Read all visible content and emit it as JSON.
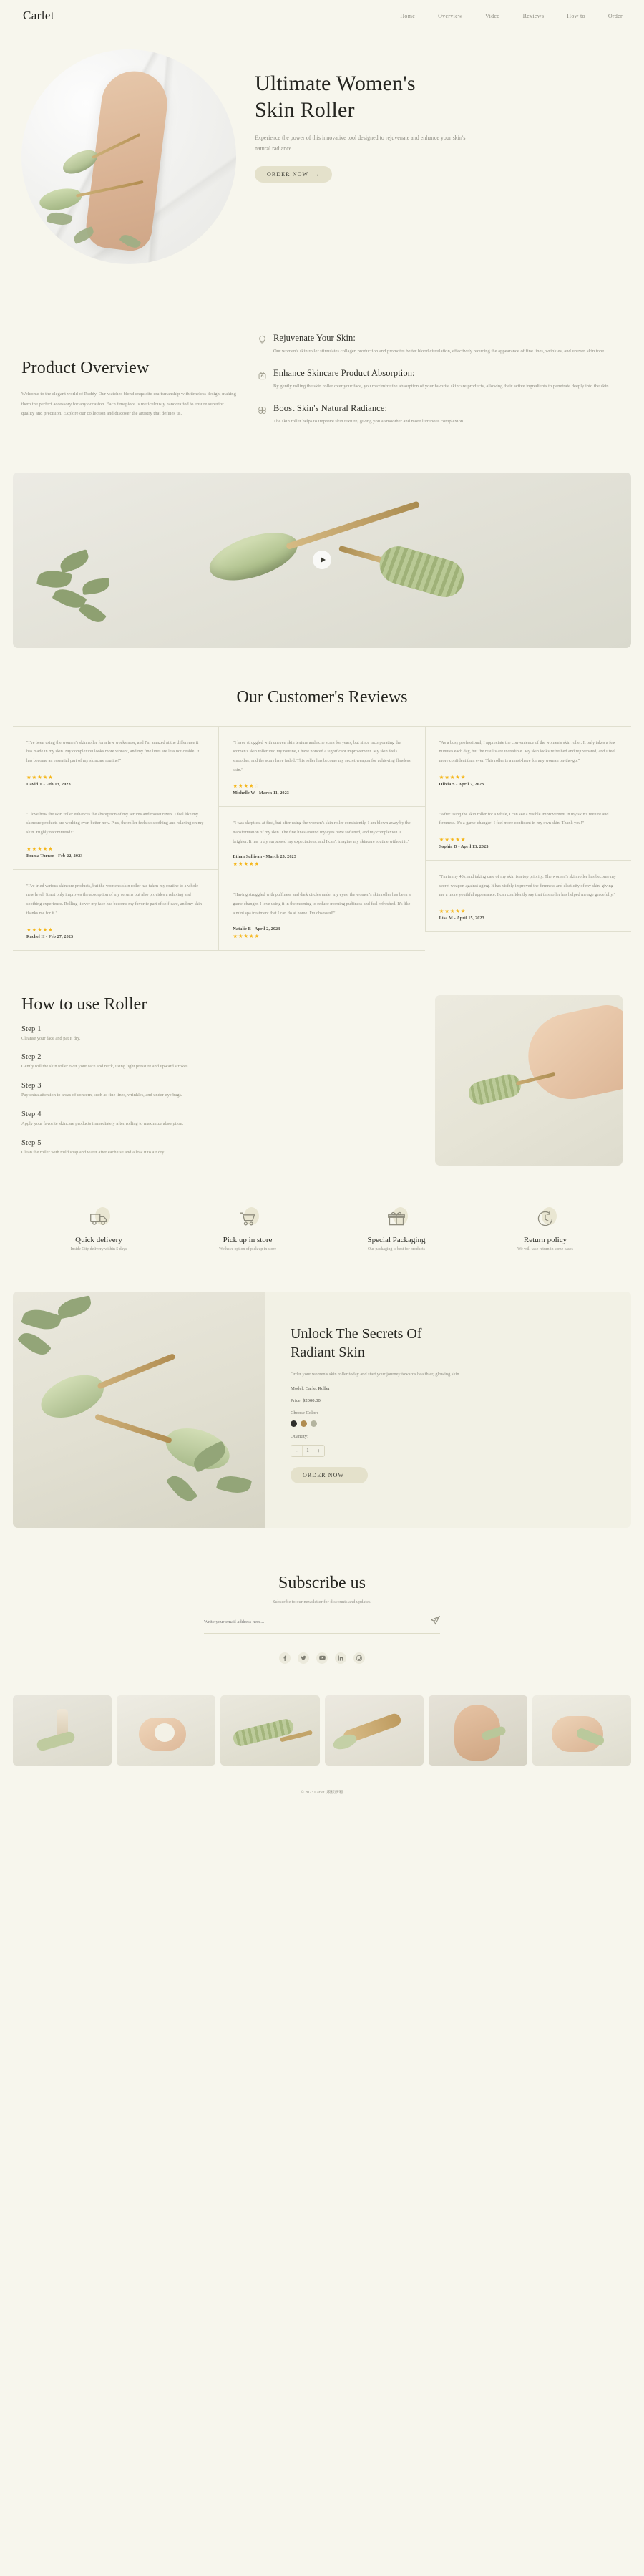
{
  "header": {
    "logo": "Carlet",
    "nav": [
      {
        "label": "Home"
      },
      {
        "label": "Overview"
      },
      {
        "label": "Video"
      },
      {
        "label": "Reviews"
      },
      {
        "label": "How to"
      },
      {
        "label": "Order"
      }
    ]
  },
  "hero": {
    "title_line1": "Ultimate Women's",
    "title_line2": "Skin Roller",
    "subtitle": "Experience the power of this innovative tool designed to rejuvenate and enhance your skin's natural radiance.",
    "cta": "ORDER NOW",
    "cta_arrow": "→"
  },
  "overview": {
    "title": "Product Overview",
    "paragraph": "Welcome to the elegant world of Reddy. Our watches blend exquisite craftsmanship with timeless design, making them the perfect accessory for any occasion. Each timepiece is meticulously handcrafted to ensure superior quality and precision. Explore our collection and discover the artistry that defines us.",
    "features": [
      {
        "icon": "lightbulb-icon",
        "title": "Rejuvenate Your Skin:",
        "text": "Our women's skin roller stimulates collagen production and promotes better blood circulation, effectively reducing the appearance of fine lines, wrinkles, and uneven skin tone."
      },
      {
        "icon": "bag-icon",
        "title": "Enhance Skincare Product Absorption:",
        "text": "By gently rolling the skin roller over your face, you maximize the absorption of your favorite skincare products, allowing their active ingredients to penetrate deeply into the skin."
      },
      {
        "icon": "sparkle-icon",
        "title": "Boost Skin's Natural Radiance:",
        "text": "The skin roller helps to improve skin texture, giving you a smoother and more luminous complexion."
      }
    ]
  },
  "video": {
    "play_label": "play-button"
  },
  "reviews": {
    "title": "Our Customer's Reviews",
    "columns": [
      [
        {
          "text": "\"I've been using the women's skin roller for a few weeks now, and I'm amazed at the difference it has made in my skin. My complexion looks more vibrant, and my fine lines are less noticeable. It has become an essential part of my skincare routine!\"",
          "rating": 5,
          "meta": "David T - Feb 13, 2023",
          "meta_first": false
        },
        {
          "text": "\"I love how the skin roller enhances the absorption of my serums and moisturizers. I feel like my skincare products are working even better now. Plus, the roller feels so soothing and relaxing on my skin. Highly recommend!\"",
          "rating": 5,
          "meta": "Emma Turner - Feb 22, 2023",
          "meta_first": false
        },
        {
          "text": "\"I've tried various skincare products, but the women's skin roller has taken my routine to a whole new level. It not only improves the absorption of my serums but also provides a relaxing and soothing experience. Rolling it over my face has become my favorite part of self-care, and my skin thanks me for it.\"",
          "rating": 5,
          "meta": "Rachel H - Feb 27, 2023",
          "meta_first": false
        }
      ],
      [
        {
          "text": "\"I have struggled with uneven skin texture and acne scars for years, but since incorporating the women's skin roller into my routine, I have noticed a significant improvement. My skin feels smoother, and the scars have faded. This roller has become my secret weapon for achieving flawless skin.\"",
          "rating": 4,
          "meta": "Michelle W - March 11, 2023",
          "meta_first": false
        },
        {
          "text": "\"I was skeptical at first, but after using the women's skin roller consistently, I am blown away by the transformation of my skin. The fine lines around my eyes have softened, and my complexion is brighter. It has truly surpassed my expectations, and I can't imagine my skincare routine without it.\"",
          "rating": 5,
          "meta": "Ethan Sullivan - March 25, 2023",
          "meta_first": true
        },
        {
          "text": "\"Having struggled with puffiness and dark circles under my eyes, the women's skin roller has been a game-changer. I love using it in the morning to reduce morning puffiness and feel refreshed. It's like a mini spa treatment that I can do at home. I'm obsessed!\"",
          "rating": 5,
          "meta": "Natalie B - April 2, 2023",
          "meta_first": true
        }
      ],
      [
        {
          "text": "\"As a busy professional, I appreciate the convenience of the women's skin roller. It only takes a few minutes each day, but the results are incredible. My skin looks refreshed and rejuvenated, and I feel more confident than ever. This roller is a must-have for any woman on-the-go.\"",
          "rating": 5,
          "meta": "Olivia S - April 7, 2023",
          "meta_first": false
        },
        {
          "text": "\"After using the skin roller for a while, I can see a visible improvement in my skin's texture and firmness. It's a game-changer! I feel more confident in my own skin. Thank you!\"",
          "rating": 5,
          "meta": "Sophia D - April 13, 2023",
          "meta_first": false
        },
        {
          "text": "\"I'm in my 40s, and taking care of my skin is a top priority. The women's skin roller has become my secret weapon against aging. It has visibly improved the firmness and elasticity of my skin, giving me a more youthful appearance. I can confidently say that this roller has helped me age gracefully.\"",
          "rating": 5,
          "meta": "Lisa M - April 15, 2023",
          "meta_first": false
        }
      ]
    ]
  },
  "howto": {
    "title": "How to use Roller",
    "steps": [
      {
        "label": "Step 1",
        "text": "Cleanse your face and pat it dry."
      },
      {
        "label": "Step 2",
        "text": "Gently roll the skin roller over your face and neck, using light pressure and upward strokes."
      },
      {
        "label": "Step 3",
        "text": "Pay extra attention to areas of concern, such as fine lines, wrinkles, and under-eye bags."
      },
      {
        "label": "Step 4",
        "text": "Apply your favorite skincare products immediately after rolling to maximize absorption."
      },
      {
        "label": "Step 5",
        "text": "Clean the roller with mild soap and water after each use and allow it to air dry."
      }
    ]
  },
  "services": [
    {
      "icon": "truck-icon",
      "title": "Quick delivery",
      "text": "Inside City delivery within 5 days"
    },
    {
      "icon": "cart-icon",
      "title": "Pick up in store",
      "text": "We have option of pick up in store"
    },
    {
      "icon": "gift-icon",
      "title": "Special Packaging",
      "text": "Our packaging is best for products"
    },
    {
      "icon": "return-icon",
      "title": "Return policy",
      "text": "We will take return in some cases"
    }
  ],
  "unlock": {
    "title_line1": "Unlock The Secrets Of",
    "title_line2": "Radiant Skin",
    "desc": "Order your women's skin roller today and start your journey towards healthier, glowing skin.",
    "model_label": "Model:",
    "model_value": "Carlet Roller",
    "price_label": "Price:",
    "price_value": "$2000.00",
    "color_label": "Choose Color:",
    "colors": [
      "#2f2f2b",
      "#b08c50",
      "#b4b49f"
    ],
    "quantity_label": "Quantity:",
    "qty_minus": "-",
    "qty_value": "1",
    "qty_plus": "+",
    "cta": "ORDER NOW",
    "cta_arrow": "→"
  },
  "subscribe": {
    "title": "Subscribe us",
    "subtitle": "Subscribe to our newsletter for discounts and updates.",
    "placeholder": "Write your email address here...",
    "send_icon": "send-icon",
    "socials": [
      "facebook-icon",
      "twitter-icon",
      "youtube-icon",
      "linkedin-icon",
      "instagram-icon"
    ]
  },
  "footer": {
    "text": "© 2023 Carlet. 版权所有"
  },
  "colors": {
    "background": "#f7f6ed",
    "ink": "#2b2b28",
    "muted": "#8c8b80",
    "button": "#e4e1cb",
    "line": "#e0dfcf",
    "star": "#f5b61a"
  }
}
